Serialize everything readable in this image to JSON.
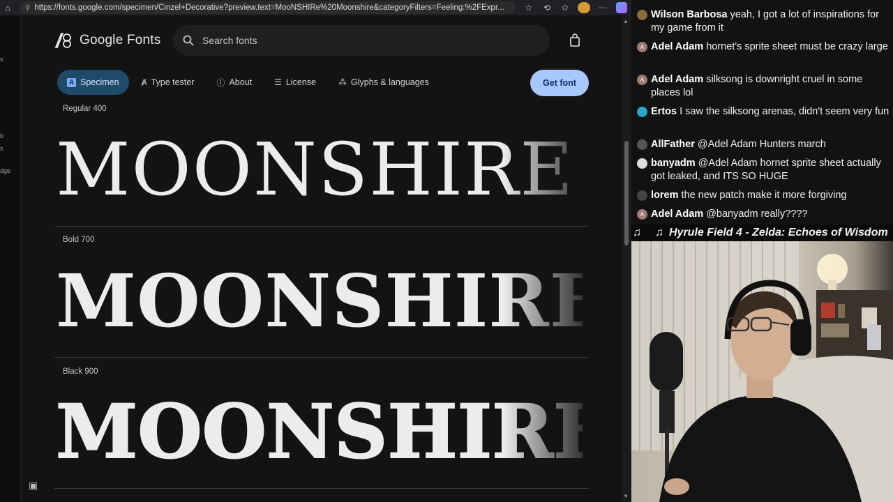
{
  "browser": {
    "url": "https://fonts.google.com/specimen/Cinzel+Decorative?preview.text=MooNSHIRe%20Moonshire&categoryFilters=Feeling:%2FExpr...",
    "left_rail_fragments": [
      "s",
      "b",
      "s",
      "dge"
    ]
  },
  "gf": {
    "brand": "Google Fonts",
    "search_placeholder": "Search fonts",
    "tabs": [
      {
        "label": "Specimen",
        "icon": "A"
      },
      {
        "label": "Type tester",
        "icon": "type-tester-icon"
      },
      {
        "label": "About",
        "icon": "info-icon"
      },
      {
        "label": "License",
        "icon": "license-icon"
      },
      {
        "label": "Glyphs & languages",
        "icon": "glyphs-icon"
      }
    ],
    "get_font": "Get font",
    "styles": [
      {
        "label": "Regular 400",
        "sample": "MOONSHIRE MOONSHIRE"
      },
      {
        "label": "Bold 700",
        "sample": "MOONSHIRE MOONSHIRE"
      },
      {
        "label": "Black 900",
        "sample": "MOONSHIRE MOONSHIRE"
      }
    ],
    "colors": {
      "accent": "#a8c7fa",
      "tab_active": "#1f4a6a",
      "background": "#131314"
    }
  },
  "chat": {
    "messages": [
      {
        "user": "Wilson Barbosa",
        "text": "yeah, I got a lot of inspirations for my game from it",
        "badge_color": "#8a6d3b",
        "badge": ""
      },
      {
        "user": "Adel Adam",
        "text": "hornet's sprite sheet must be crazy large",
        "badge_color": "#9e7b73",
        "badge": "A"
      },
      {
        "user": "Adel Adam",
        "text": "silksong is downright cruel in some places lol",
        "badge_color": "#9e7b73",
        "badge": "A"
      },
      {
        "user": "Ertos",
        "text": "I saw the silksong arenas, didn't seem very fun",
        "badge_color": "#2aa5c9",
        "badge": ""
      },
      {
        "user": "AllFather",
        "text": "@Adel Adam Hunters march",
        "badge_color": "#555555",
        "badge": ""
      },
      {
        "user": "banyadm",
        "text": "@Adel Adam hornet sprite sheet actually got leaked, and ITS SO HUGE",
        "badge_color": "#dddddd",
        "badge": ""
      },
      {
        "user": "lorem",
        "text": "the new patch make it more forgiving",
        "badge_color": "#444444",
        "badge": ""
      },
      {
        "user": "Adel Adam",
        "text": "@banyadm really????",
        "badge_color": "#9e7b73",
        "badge": "A"
      }
    ]
  },
  "now_playing": {
    "note_icon": "♫",
    "song": "Hyrule Field 4 - Zelda: Echoes of Wisdom"
  }
}
